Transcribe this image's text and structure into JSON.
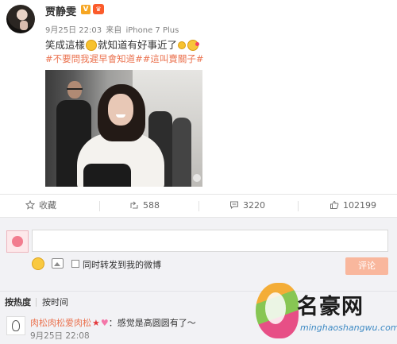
{
  "post": {
    "username": "贾静雯",
    "verified_badge": "V",
    "member_badge": "♛",
    "time": "9月25日 22:03",
    "source_prefix": "来自",
    "source": "iPhone 7 Plus",
    "text_part1": "笑成這樣",
    "text_part2": "就知道有好事近了",
    "hashtags": "#不要問我遲早會知道##這叫賣關子#"
  },
  "actions": {
    "favorite_label": "收藏",
    "share_count": "588",
    "comment_count": "3220",
    "like_count": "102199"
  },
  "comment_box": {
    "input_value": "",
    "forward_label": "同时转发到我的微博",
    "submit_label": "评论"
  },
  "sort": {
    "hot_label": "按热度",
    "time_label": "按时间"
  },
  "comment": {
    "user": "肉松肉松爱肉松",
    "star": "★",
    "heart": "♥",
    "text": "：感觉是高圆圆有了～",
    "time": "9月25日 22:08"
  },
  "watermark": {
    "title": "名豪网",
    "url": "minghaoshangwu.com"
  },
  "colors": {
    "link_orange": "#eb7350",
    "submit_disabled": "#f9b79d",
    "panel_bg": "#f2f2f5"
  },
  "icons": [
    "avatar",
    "verified-icon",
    "member-crown-icon",
    "smile-emoji-icon",
    "grin-emoji-icon",
    "kiss-emoji-icon",
    "star-icon",
    "share-icon",
    "comment-icon",
    "thumb-up-icon",
    "smiley-icon",
    "image-icon",
    "checkbox"
  ]
}
